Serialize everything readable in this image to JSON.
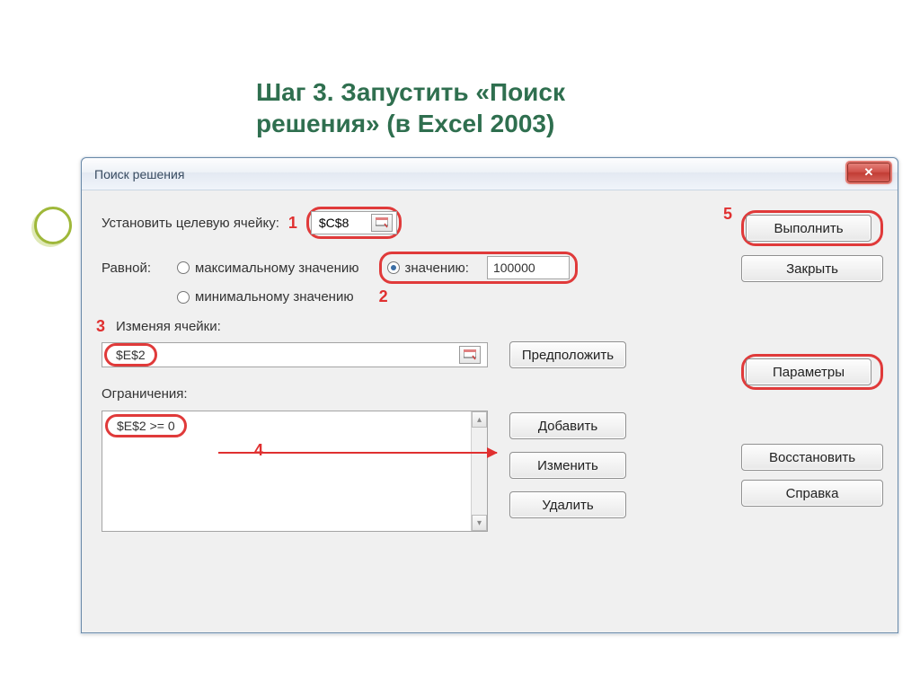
{
  "slide": {
    "title": "Шаг 3. Запустить  «Поиск решения» (в Excel 2003)"
  },
  "dialog": {
    "title": "Поиск решения",
    "labels": {
      "target_cell": "Установить целевую ячейку:",
      "equal_to": "Равной:",
      "changing_cells": "Изменяя ячейки:",
      "constraints": "Ограничения:"
    },
    "target_cell_value": "$C$8",
    "radios": {
      "max": "максимальному значению",
      "min": "минимальному значению",
      "value": "значению:"
    },
    "value_input": "100000",
    "changing_cells_value": "$E$2",
    "constraint_item": "$E$2 >= 0",
    "buttons": {
      "execute": "Выполнить",
      "close": "Закрыть",
      "guess": "Предположить",
      "params": "Параметры",
      "add": "Добавить",
      "change": "Изменить",
      "delete": "Удалить",
      "restore": "Восстановить",
      "help": "Справка"
    }
  },
  "annotations": {
    "n1": "1",
    "n2": "2",
    "n3": "3",
    "n4": "4",
    "n5": "5"
  }
}
